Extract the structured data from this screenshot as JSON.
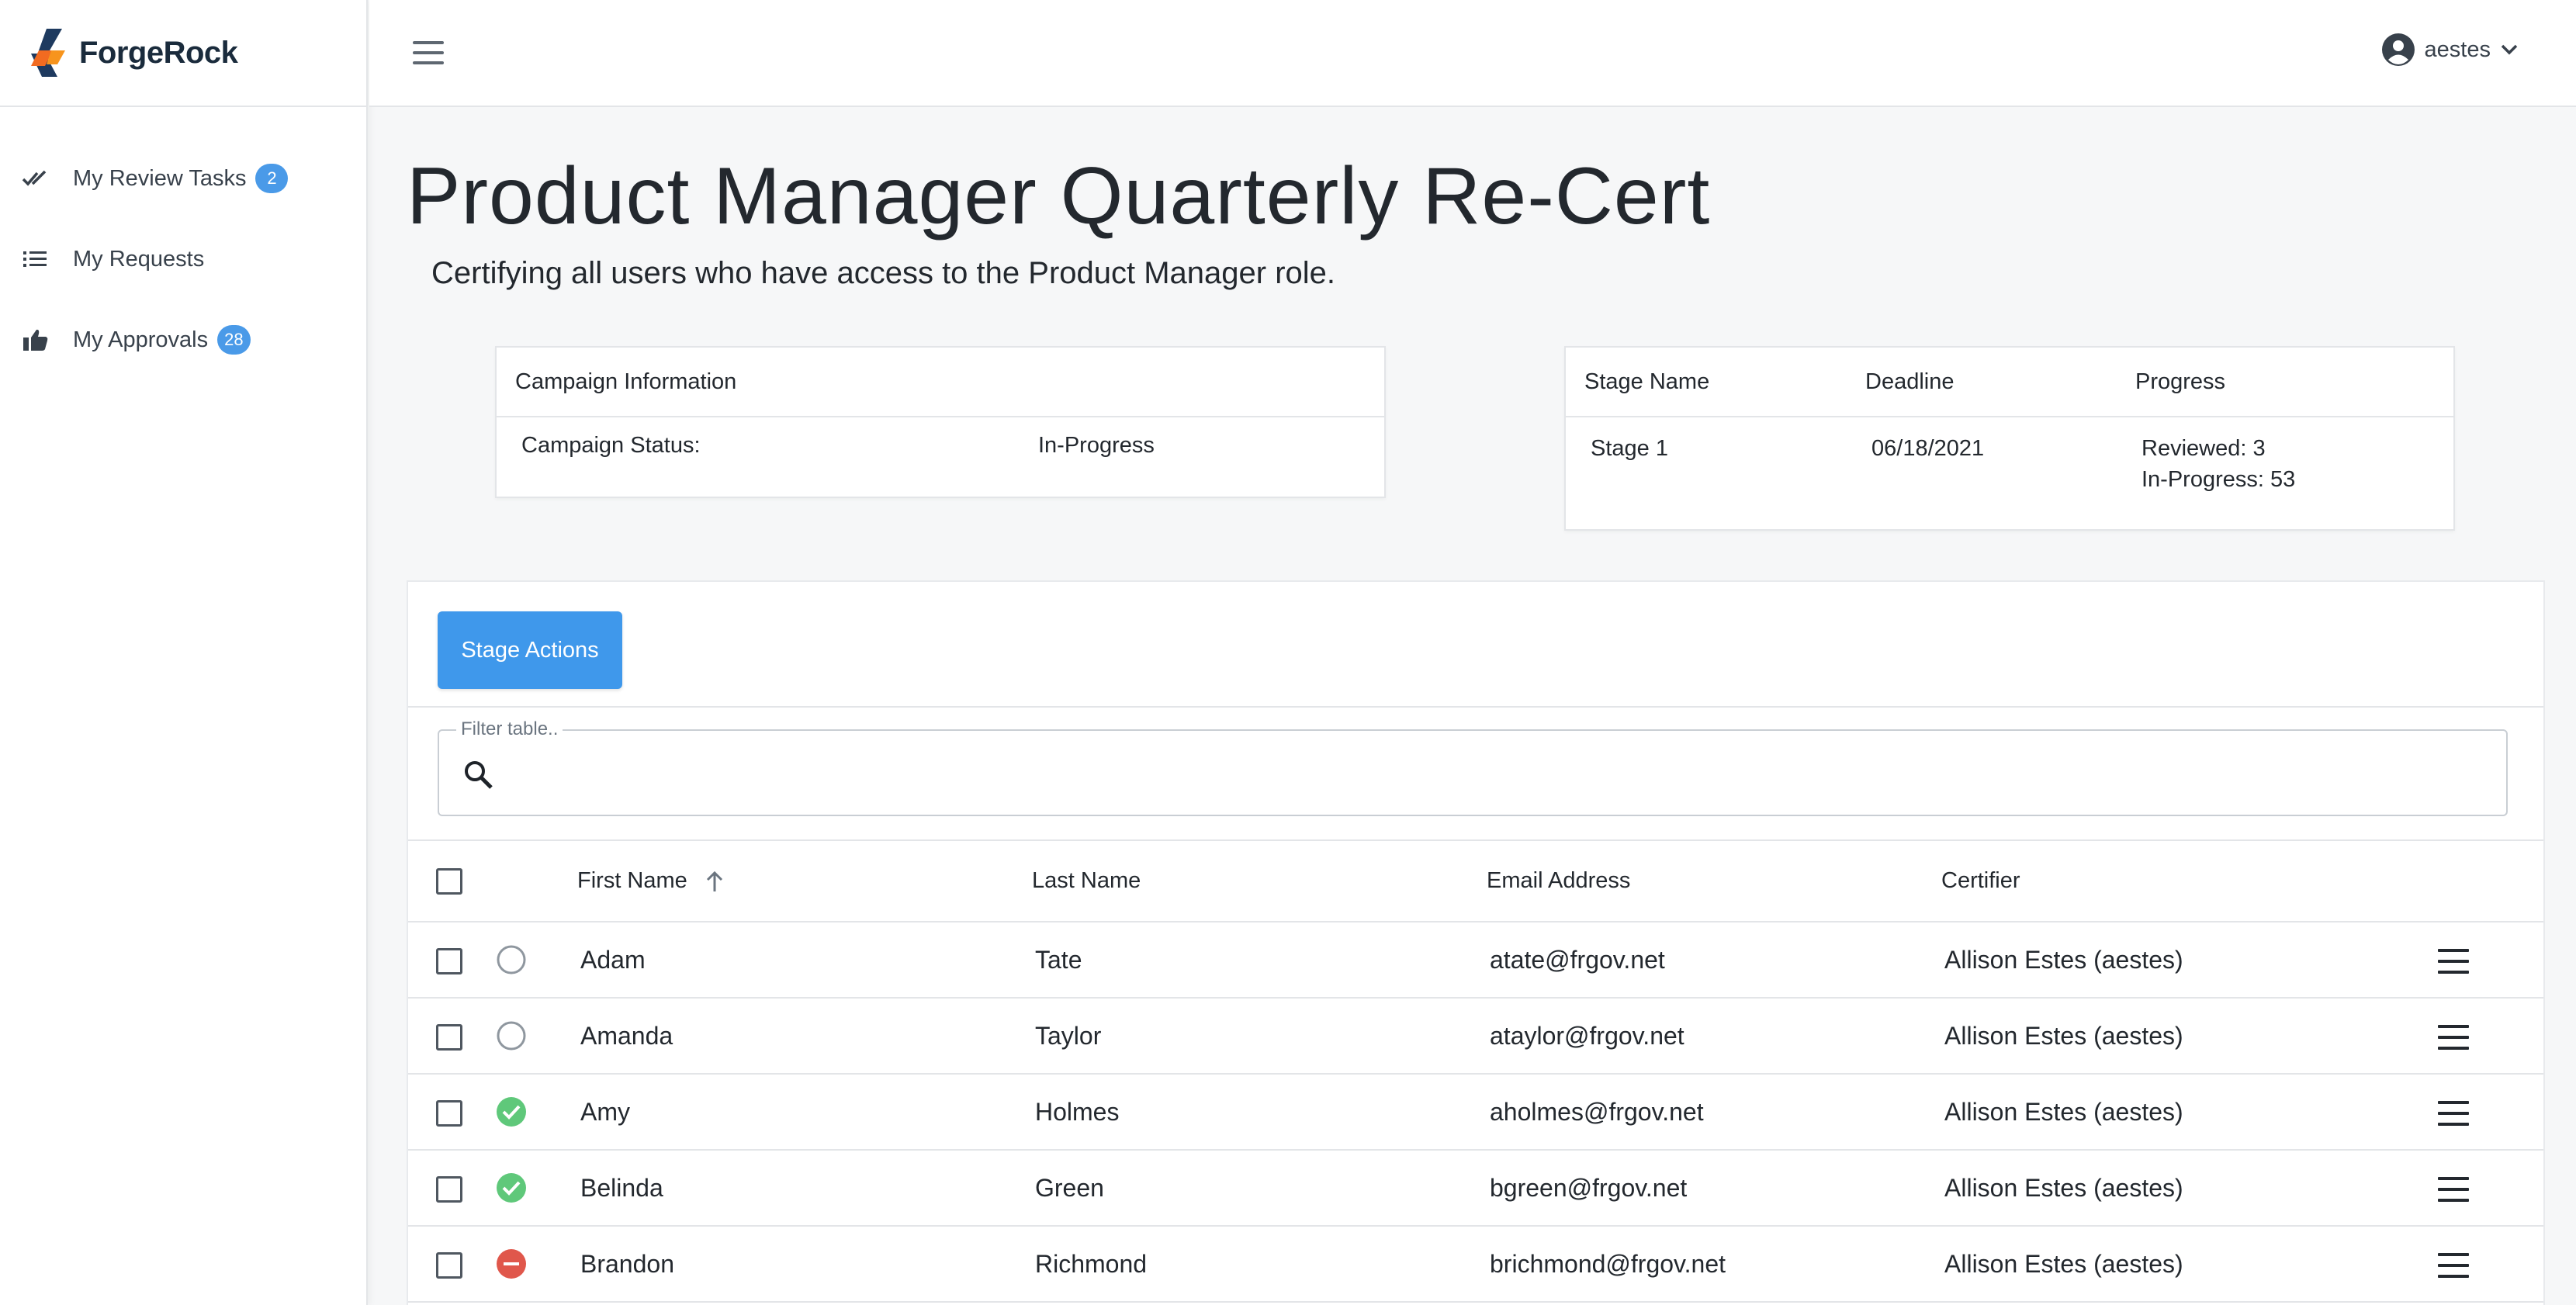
{
  "brand": {
    "name": "ForgeRock"
  },
  "sidebar": {
    "items": [
      {
        "label": "My Review Tasks",
        "badge": "2",
        "icon": "double-check-icon"
      },
      {
        "label": "My Requests",
        "badge": "",
        "icon": "list-icon"
      },
      {
        "label": "My Approvals",
        "badge": "28",
        "icon": "thumbs-up-icon"
      }
    ]
  },
  "header": {
    "user": "aestes"
  },
  "page": {
    "title": "Product Manager Quarterly Re-Cert",
    "subtitle": "Certifying all users who have access to the Product Manager role."
  },
  "campaign": {
    "heading": "Campaign Information",
    "status_label": "Campaign Status:",
    "status_value": "In-Progress"
  },
  "stage": {
    "headers": {
      "name": "Stage Name",
      "deadline": "Deadline",
      "progress": "Progress"
    },
    "name": "Stage 1",
    "deadline": "06/18/2021",
    "reviewed": "Reviewed: 3",
    "in_progress": "In-Progress: 53"
  },
  "toolbar": {
    "stage_actions": "Stage Actions"
  },
  "filter": {
    "label": "Filter table..",
    "value": ""
  },
  "table": {
    "columns": {
      "first": "First Name",
      "last": "Last Name",
      "email": "Email Address",
      "certifier": "Certifier"
    },
    "sort": {
      "column": "First Name",
      "direction": "ascending"
    },
    "rows": [
      {
        "first": "Adam",
        "last": "Tate",
        "email": "atate@frgov.net",
        "certifier": "Allison Estes (aestes)",
        "status": "pending"
      },
      {
        "first": "Amanda",
        "last": "Taylor",
        "email": "ataylor@frgov.net",
        "certifier": "Allison Estes (aestes)",
        "status": "pending"
      },
      {
        "first": "Amy",
        "last": "Holmes",
        "email": "aholmes@frgov.net",
        "certifier": "Allison Estes (aestes)",
        "status": "certified"
      },
      {
        "first": "Belinda",
        "last": "Green",
        "email": "bgreen@frgov.net",
        "certifier": "Allison Estes (aestes)",
        "status": "certified"
      },
      {
        "first": "Brandon",
        "last": "Richmond",
        "email": "brichmond@frgov.net",
        "certifier": "Allison Estes (aestes)",
        "status": "revoked"
      }
    ]
  },
  "colors": {
    "accent": "#3f98eb",
    "badge": "#4a9ae8",
    "certified": "#5fc87a",
    "revoked": "#e0574b",
    "pending": "#8f979f",
    "logo_orange": "#f26b21",
    "logo_navy": "#1e3a5f"
  }
}
